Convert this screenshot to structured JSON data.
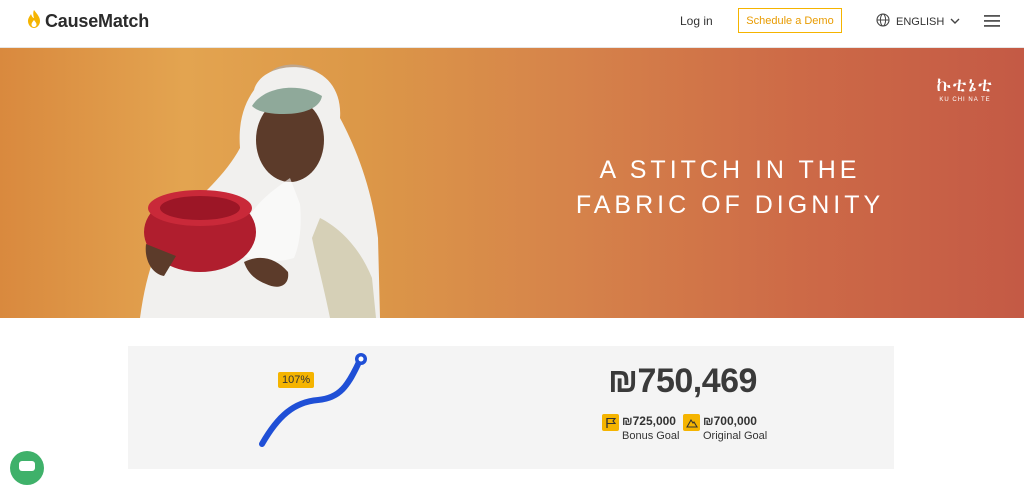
{
  "header": {
    "logo_text": "CauseMatch",
    "login_label": "Log in",
    "demo_label": "Schedule a Demo",
    "language_label": "ENGLISH"
  },
  "hero": {
    "title_line1": "A STITCH IN THE",
    "title_line2": "FABRIC OF DIGNITY",
    "brand_glyphs": "ኩቲኔቲ",
    "brand_sub": "KU CHI NA TE"
  },
  "campaign": {
    "percent_label": "107%",
    "raised": "₪750,469",
    "bonus_goal_value": "₪725,000",
    "bonus_goal_label": "Bonus Goal",
    "original_goal_value": "₪700,000",
    "original_goal_label": "Original Goal"
  },
  "colors": {
    "accent": "#f5b400",
    "progress": "#1f4fd6"
  }
}
